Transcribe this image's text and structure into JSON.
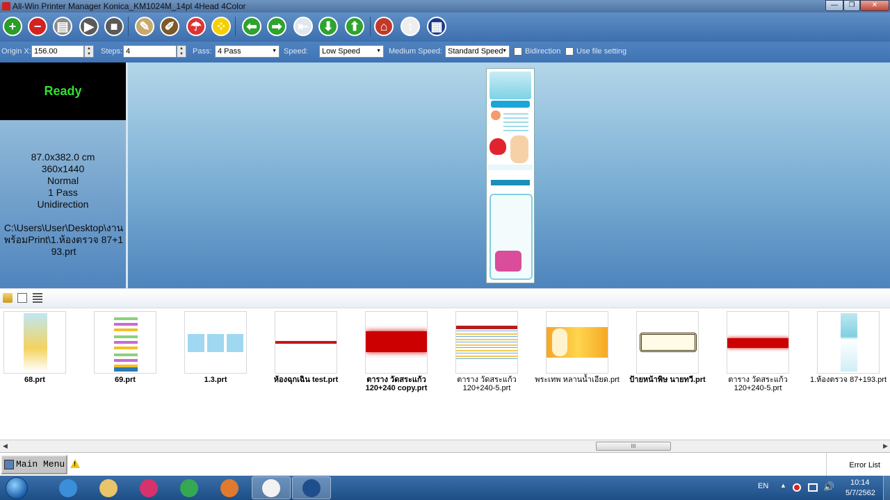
{
  "window": {
    "title": "All-Win  Printer Manager Konica_KM1024M_14pl 4Head 4Color",
    "min_label": "—",
    "max_label": "❐",
    "close_label": "✕"
  },
  "toolbar": {
    "buttons": [
      {
        "name": "add",
        "icon": "plus-icon",
        "glyph": "+",
        "color": "#2a9d2a"
      },
      {
        "name": "remove",
        "icon": "minus-icon",
        "glyph": "−",
        "color": "#d32222"
      },
      {
        "name": "printer",
        "icon": "printer-icon",
        "glyph": "▤",
        "color": "#8a8a8a"
      },
      {
        "name": "play",
        "icon": "play-icon",
        "glyph": "▶",
        "color": "#5a5a5a"
      },
      {
        "name": "stop",
        "icon": "stop-icon",
        "glyph": "■",
        "color": "#5a5a5a"
      },
      {
        "name": "clean",
        "icon": "clean-icon",
        "glyph": "✎",
        "color": "#c9a86b"
      },
      {
        "name": "brush",
        "icon": "brush-icon",
        "glyph": "✐",
        "color": "#7a5a2a"
      },
      {
        "name": "spray",
        "icon": "spray-icon",
        "glyph": "☂",
        "color": "#d33"
      },
      {
        "name": "color",
        "icon": "color-dots-icon",
        "glyph": "⁘",
        "color": "#f5d000"
      },
      {
        "name": "move-left",
        "icon": "arrow-left-icon",
        "glyph": "⬅",
        "color": "#2ea32e"
      },
      {
        "name": "move-right",
        "icon": "arrow-right-icon",
        "glyph": "➡",
        "color": "#2ea32e"
      },
      {
        "name": "origin",
        "icon": "origin-icon",
        "glyph": "⇤",
        "color": "#dfe6ef"
      },
      {
        "name": "move-down",
        "icon": "arrow-down-icon",
        "glyph": "⬇",
        "color": "#2ea32e"
      },
      {
        "name": "move-up",
        "icon": "arrow-up-icon",
        "glyph": "⬆",
        "color": "#2ea32e"
      },
      {
        "name": "home",
        "icon": "home-icon",
        "glyph": "⌂",
        "color": "#c0392b"
      },
      {
        "name": "measure",
        "icon": "measure-icon",
        "glyph": "↕",
        "color": "#eeeeee"
      },
      {
        "name": "settings",
        "icon": "settings-window-icon",
        "glyph": "▦",
        "color": "#1e3a8a"
      }
    ]
  },
  "params": {
    "origin_x_label": "Origin X:",
    "origin_x_value": "156.00",
    "steps_label": "Steps:",
    "steps_value": "4",
    "pass_label": "Pass:",
    "pass_value": "4 Pass",
    "speed_label": "Speed:",
    "speed_value": "Low Speed",
    "medium_speed_label": "Medium Speed:",
    "medium_speed_value": "Standard Speed",
    "bidirection_label": "Bidirection",
    "bidirection_checked": false,
    "use_file_setting_label": "Use file setting",
    "use_file_setting_checked": false
  },
  "status": {
    "state": "Ready",
    "size": "87.0x382.0 cm",
    "resolution": "360x1440",
    "mode": "Normal",
    "passes": "1 Pass",
    "direction": "Unidirection",
    "file_path": "C:\\Users\\User\\Desktop\\งานพร้อมPrint\\1.ห้องตรวจ 87+193.prt"
  },
  "files": [
    {
      "name": "68.prt",
      "bold": true,
      "thumb": "poster"
    },
    {
      "name": "69.prt",
      "bold": true,
      "thumb": "bands"
    },
    {
      "name": "1.3.prt",
      "bold": true,
      "thumb": "tiles"
    },
    {
      "name": "ห้องฉุกเฉิน test.prt",
      "bold": true,
      "thumb": "redline"
    },
    {
      "name": "ตาราง วัดสระแก้ว 120+240 copy.prt",
      "bold": true,
      "thumb": "redband"
    },
    {
      "name": "ตาราง วัดสระแก้ว 120+240-5.prt",
      "bold": false,
      "thumb": "table"
    },
    {
      "name": "พระเทพ หลานน้ำเอียด.prt",
      "bold": false,
      "thumb": "yellow"
    },
    {
      "name": "ป้ายหน้าพิษ นายทวี.prt",
      "bold": true,
      "thumb": "plaque"
    },
    {
      "name": "ตาราง วัดสระแก้ว 120+240-5.prt",
      "bold": false,
      "thumb": "redband2"
    },
    {
      "name": "1.ห้องตรวจ 87+193.prt",
      "bold": false,
      "thumb": "poster2"
    }
  ],
  "statusbar": {
    "main_menu_label": "Main Menu",
    "error_list_label": "Error List"
  },
  "taskbar": {
    "items": [
      "ie-icon",
      "folder-icon",
      "swirl-icon",
      "chrome-icon",
      "media-icon",
      "paint-icon",
      "pp-icon"
    ],
    "lang": "EN",
    "time": "10:14",
    "date": "5/7/2562"
  }
}
